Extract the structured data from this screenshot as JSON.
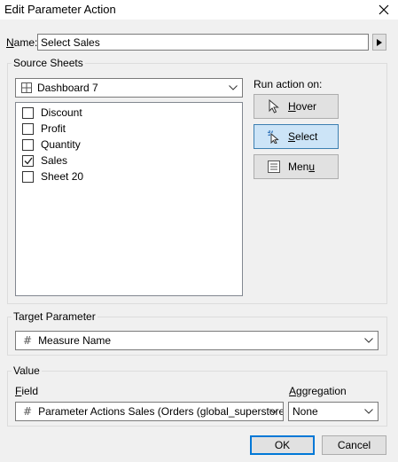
{
  "window": {
    "title": "Edit Parameter Action"
  },
  "name": {
    "label_key": "N",
    "label_rest": "ame:",
    "value": "Select Sales"
  },
  "source_sheets": {
    "title": "Source Sheets",
    "dashboard": "Dashboard 7",
    "sheets": [
      {
        "label": "Discount",
        "checked": false
      },
      {
        "label": "Profit",
        "checked": false
      },
      {
        "label": "Quantity",
        "checked": false
      },
      {
        "label": "Sales",
        "checked": true
      },
      {
        "label": "Sheet 20",
        "checked": false
      }
    ]
  },
  "run_action": {
    "label": "Run action on:",
    "hover": {
      "key": "H",
      "rest": "over"
    },
    "select": {
      "key": "S",
      "rest": "elect",
      "selected": true
    },
    "menu": {
      "pre": "Men",
      "key": "u",
      "rest": ""
    }
  },
  "target_parameter": {
    "title": "Target Parameter",
    "value": "Measure Name"
  },
  "value_section": {
    "title": "Value",
    "field_key": "F",
    "field_rest": "ield",
    "field_value": "Parameter Actions Sales (Orders (global_superstore))",
    "aggregation_key": "A",
    "aggregation_rest": "ggregation",
    "aggregation_value": "None"
  },
  "buttons": {
    "ok": "OK",
    "cancel": "Cancel"
  },
  "colors": {
    "selected_bg": "#cce4f7",
    "default_border": "#0078d7"
  }
}
